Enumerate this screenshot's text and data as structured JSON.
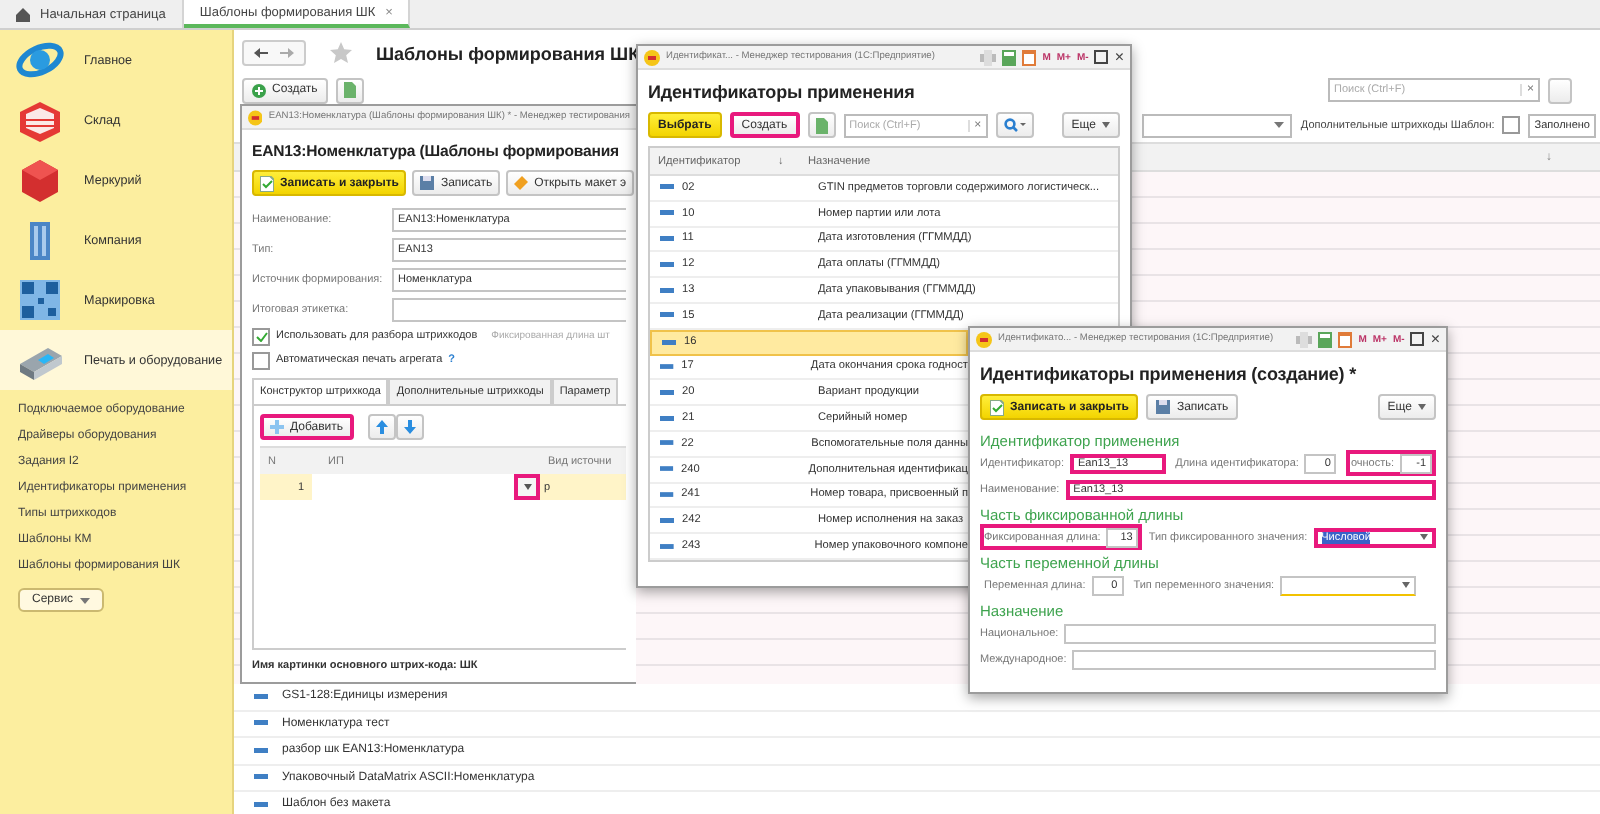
{
  "tabs": [
    {
      "label": "Начальная страница",
      "selected": false
    },
    {
      "label": "Шаблоны формирования ШК",
      "selected": true,
      "close": "×"
    }
  ],
  "sidebar": {
    "sections": [
      {
        "label": "Главное",
        "selected": false
      },
      {
        "label": "Склад",
        "selected": false
      },
      {
        "label": "Меркурий",
        "selected": false
      },
      {
        "label": "Компания",
        "selected": false
      },
      {
        "label": "Маркировка",
        "selected": false
      },
      {
        "label": "Печать и оборудование",
        "selected": true
      }
    ],
    "links": [
      "Подключаемое оборудование",
      "Драйверы оборудования",
      "Задания I2",
      "Идентификаторы применения",
      "Типы штрихкодов",
      "Шаблоны КМ",
      "Шаблоны формирования ШК"
    ],
    "service_button": "Сервис"
  },
  "page": {
    "title": "Шаблоны формирования ШК",
    "create_button": "Создать",
    "search": {
      "placeholder": "Поиск (Ctrl+F)",
      "clear": "×"
    },
    "filter": {
      "label": "Дополнительные штрихкоды Шаблон:",
      "checked": false
    },
    "status_field": "Заполнено",
    "sort": "↓",
    "rows": [
      "GS1-128:Единицы измерения",
      "Номенклатура тест",
      "разбор шк EAN13:Номенклатура",
      "Упаковочный DataMatrix ASCII:Номенклатура",
      "Шаблон без макета"
    ]
  },
  "template_window": {
    "title": "EAN13:Номенклатура (Шаблоны формирования ШК) * - Менеджер тестирования",
    "heading": "EAN13:Номенклатура (Шаблоны формирования",
    "buttons": [
      {
        "label": "Записать и закрыть",
        "kind": "primary"
      },
      {
        "label": "Записать",
        "kind": "save"
      },
      {
        "label": "Открыть макет э",
        "kind": "template"
      }
    ],
    "fields": [
      {
        "label": "Наименование:",
        "value": "EAN13:Номенклатура"
      },
      {
        "label": "Тип:",
        "value": "EAN13"
      },
      {
        "label": "Источник формирования:",
        "value": "Номенклатура"
      },
      {
        "label": "Итоговая этикетка:"
      }
    ],
    "checkboxes": [
      {
        "label": "Использовать для разбора штрихкодов",
        "checked": true,
        "note": "Фиксированная длина шт"
      },
      {
        "label": "Автоматическая печать агрегата",
        "checked": false,
        "help": "?"
      }
    ],
    "tabs": [
      {
        "label": "Конструктор штрихкода",
        "selected": true
      },
      {
        "label": "Дополнительные штрихкоды",
        "selected": false
      },
      {
        "label": "Параметр",
        "selected": false
      }
    ],
    "add_button": {
      "label": "Добавить",
      "highlighted": true
    },
    "table": {
      "columns": [
        "N",
        "ИП",
        "Вид источни"
      ],
      "rows": [
        {
          "n": "1",
          "trail": "р",
          "selected": true,
          "dropdown_highlighted": true
        }
      ]
    },
    "footer": "Имя картинки основного штрих-кода: ШК"
  },
  "ids_window": {
    "title": "Идентификат... - Менеджер тестирования (1С:Предприятие)",
    "title_buttons": [
      "M",
      "M+",
      "M-"
    ],
    "close_button": "×",
    "heading": "Идентификаторы применения",
    "select_button": "Выбрать",
    "create_button": {
      "label": "Создать",
      "highlighted": true
    },
    "search": {
      "placeholder": "Поиск (Ctrl+F)",
      "clear": "×"
    },
    "more_button": "Еще",
    "columns": [
      "Идентификатор",
      "Назначение"
    ],
    "sort": "↓",
    "rows": [
      {
        "id": "02",
        "purpose": "GTIN предметов торговли содержимого логистическ...",
        "selected": false
      },
      {
        "id": "10",
        "purpose": "Номер партии или лота",
        "selected": false
      },
      {
        "id": "11",
        "purpose": "Дата изготовления (ГГММДД)",
        "selected": false
      },
      {
        "id": "12",
        "purpose": "Дата оплаты (ГГММДД)",
        "selected": false
      },
      {
        "id": "13",
        "purpose": "Дата упаковывания (ГГММДД)",
        "selected": false
      },
      {
        "id": "15",
        "purpose": "Дата реализации (ГГММДД)",
        "selected": false
      },
      {
        "id": "16",
        "selected": true
      },
      {
        "id": "17",
        "purpose": "Дата окончания срока годност",
        "selected": false
      },
      {
        "id": "20",
        "purpose": "Вариант продукции",
        "selected": false
      },
      {
        "id": "21",
        "purpose": "Серийный номер",
        "selected": false
      },
      {
        "id": "22",
        "purpose": "Вспомогательные поля данны",
        "selected": false
      },
      {
        "id": "240",
        "purpose": "Дополнительная идентификац",
        "selected": false
      },
      {
        "id": "241",
        "purpose": "Номер товара, присвоенный п",
        "selected": false
      },
      {
        "id": "242",
        "purpose": "Номер исполнения на заказ",
        "selected": false
      },
      {
        "id": "243",
        "purpose": "Номер упаковочного компоне",
        "selected": false
      }
    ]
  },
  "create_window": {
    "title": "Идентификато... - Менеджер тестирования (1С:Предприятие)",
    "title_buttons": [
      "M",
      "M+",
      "M-"
    ],
    "close_button": "×",
    "heading": "Идентификаторы применения (создание) *",
    "buttons": [
      {
        "label": "Записать и закрыть",
        "kind": "primary"
      },
      {
        "label": "Записать",
        "kind": "save"
      }
    ],
    "more_button": "Еще",
    "sections": [
      {
        "title": "Идентификатор применения",
        "rows": [
          [
            {
              "label": "Идентификатор:",
              "value": "Ean13_13",
              "kind": "text",
              "highlighted": true
            },
            {
              "label": "Длина идентификатора:",
              "value": "0",
              "kind": "number",
              "highlighted": false
            },
            {
              "label": "очность:",
              "value": "-1",
              "kind": "number",
              "highlighted": true
            }
          ],
          [
            {
              "label": "Наименование:",
              "value": "Ean13_13",
              "kind": "wide",
              "highlighted": true
            }
          ]
        ]
      },
      {
        "title": "Часть фиксированной длины",
        "rows": [
          [
            {
              "label": "Фиксированная длина:",
              "value": "13",
              "kind": "number",
              "highlighted": true
            },
            {
              "label": "Тип фиксированного значения:",
              "value": "Числовой",
              "kind": "select",
              "highlighted": true,
              "value_selected": true
            }
          ]
        ]
      },
      {
        "title": "Часть переменной длины",
        "rows": [
          [
            {
              "label": "Переменная длина:",
              "value": "0",
              "kind": "number",
              "highlighted": false
            },
            {
              "label": "Тип переменного значения:",
              "kind": "select",
              "highlighted": false
            }
          ]
        ]
      },
      {
        "title": "Назначение",
        "rows": [
          [
            {
              "label": "Национальное:",
              "kind": "wide",
              "highlighted": false
            }
          ],
          [
            {
              "label": "Международное:",
              "kind": "wide",
              "highlighted": false
            }
          ]
        ]
      }
    ]
  }
}
